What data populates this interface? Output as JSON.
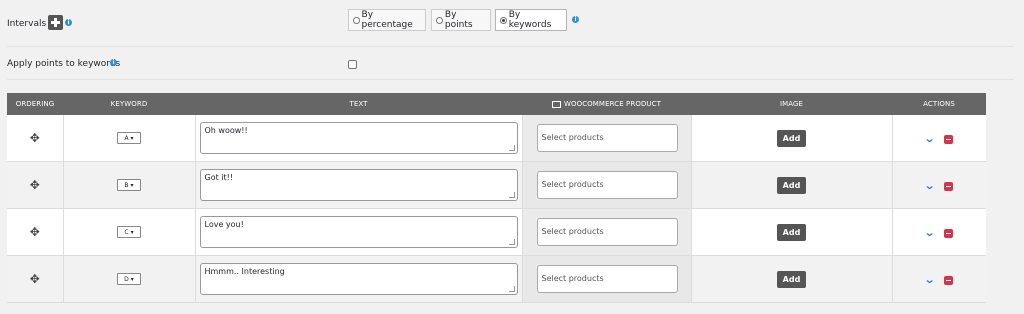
{
  "intervals": {
    "label": "Intervals",
    "options": [
      {
        "label": "By percentage",
        "checked": false
      },
      {
        "label": "By points",
        "checked": false
      },
      {
        "label": "By keywords",
        "checked": true
      }
    ]
  },
  "apply_points": {
    "label": "Apply points to keywords",
    "checked": false
  },
  "table": {
    "headers": {
      "ordering": "ORDERING",
      "keyword": "KEYWORD",
      "text": "TEXT",
      "product": "WOOCOMMERCE PRODUCT",
      "image": "IMAGE",
      "actions": "ACTIONS"
    },
    "rows": [
      {
        "keyword": "A",
        "text": "Oh woow!!",
        "product_placeholder": "Select products",
        "image_button": "Add"
      },
      {
        "keyword": "B",
        "text": "Got it!!",
        "product_placeholder": "Select products",
        "image_button": "Add"
      },
      {
        "keyword": "C",
        "text": "Love you!",
        "product_placeholder": "Select products",
        "image_button": "Add"
      },
      {
        "keyword": "D",
        "text": "Hmmm.. Interesting",
        "product_placeholder": "Select products",
        "image_button": "Add"
      }
    ]
  },
  "icons": {
    "info": "info-icon",
    "add": "plus-icon",
    "move": "move-icon",
    "expand": "chevron-down-icon",
    "remove": "remove-icon"
  },
  "colors": {
    "header_bg": "#666666",
    "accent_blue": "#1e7bd8",
    "remove_red": "#d6334c",
    "button_dark": "#555555"
  }
}
